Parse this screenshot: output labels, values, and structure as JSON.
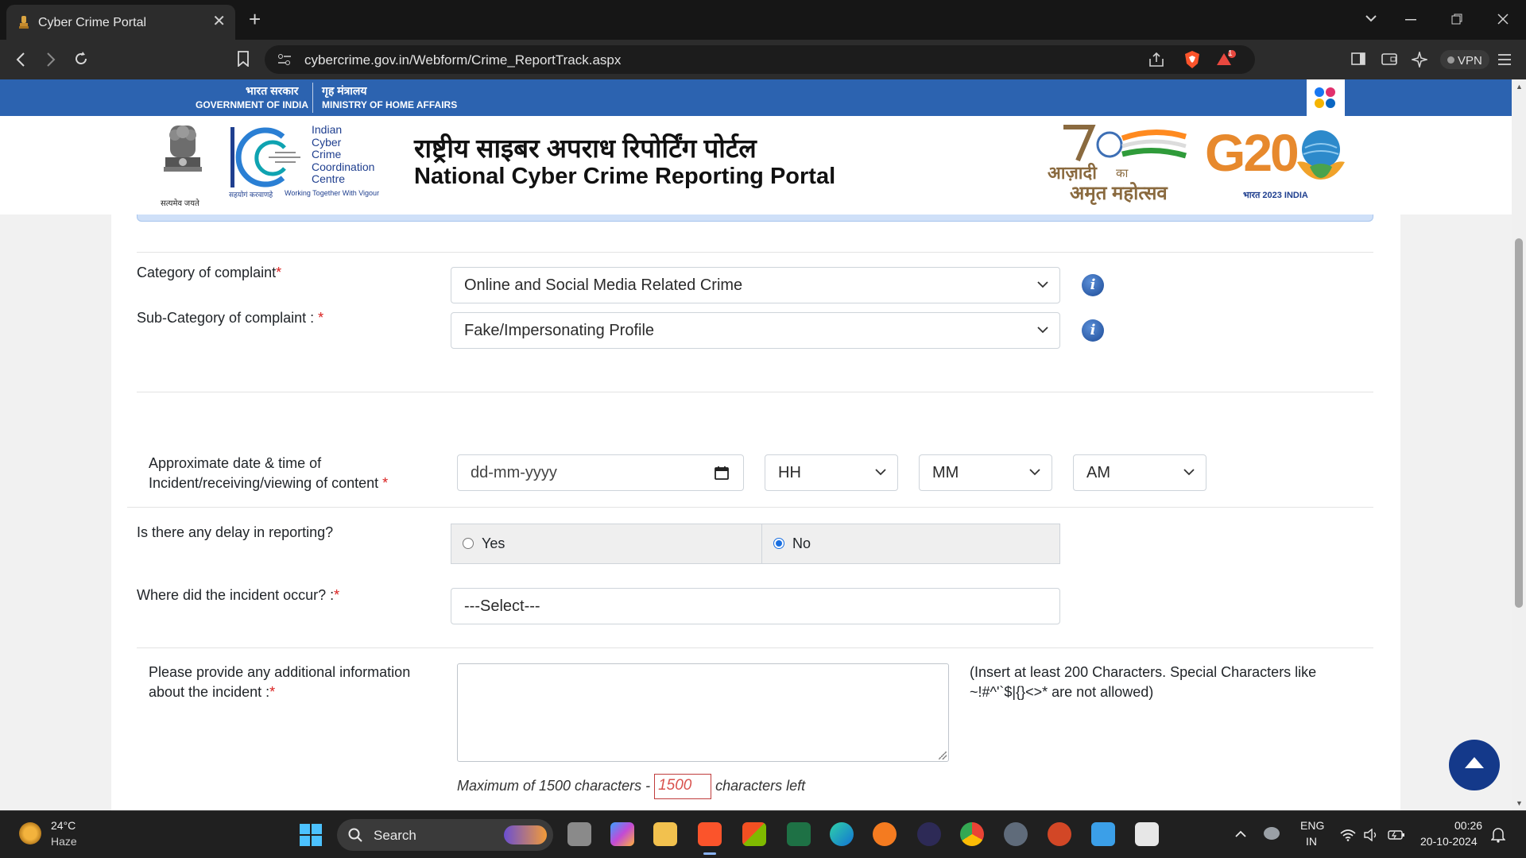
{
  "browser": {
    "tab_title": "Cyber Crime Portal",
    "tab_close": "✕",
    "new_tab": "+",
    "url": "cybercrime.gov.in/Webform/Crime_ReportTrack.aspx",
    "vpn_label": "VPN",
    "badge_count": "1"
  },
  "gov_bar": {
    "hindi_gov": "भारत सरकार",
    "english_gov": "GOVERNMENT OF INDIA",
    "hindi_ministry": "गृह मंत्रालय",
    "english_ministry": "MINISTRY OF HOME AFFAIRS"
  },
  "header": {
    "i4c_lines": [
      "Indian",
      "Cyber",
      "Crime",
      "Coordination",
      "Centre"
    ],
    "i4c_tagline_hi": "सहयोगं करवाणहे",
    "i4c_tagline_en": "Working Together With Vigour",
    "emblem_caption": "सत्यमेव जयते",
    "title_hindi": "राष्ट्रीय साइबर अपराध रिपोर्टिंग पोर्टल",
    "title_english": "National Cyber Crime Reporting Portal",
    "azadi_line1": "आज़ादी",
    "azadi_ka": "का",
    "azadi_line2": "अमृत महोत्सव",
    "g20_text": "G20",
    "g20_sub": "भारत 2023 INDIA"
  },
  "form": {
    "category_label": "Category of complaint",
    "category_value": "Online and Social Media Related Crime",
    "subcategory_label": "Sub-Category of complaint : ",
    "subcategory_value": "Fake/Impersonating Profile",
    "datetime_label": "Approximate date & time of Incident/receiving/viewing of content ",
    "date_placeholder": "dd-mm-yyyy",
    "hour_value": "HH",
    "minute_value": "MM",
    "ampm_value": "AM",
    "delay_label": "Is there any delay in reporting?",
    "delay_yes": "Yes",
    "delay_no": "No",
    "delay_selected": "No",
    "location_label": "Where did the incident occur? :",
    "location_value": "---Select---",
    "info_label": "Please provide any additional information about the incident :",
    "info_hint": "(Insert at least 200 Characters. Special Characters like ~!#^'`$|{}<>* are not allowed)",
    "counter_prefix": "Maximum of 1500 characters - ",
    "counter_value": "1500",
    "counter_suffix": " characters left",
    "required_mark": "*",
    "info_icon_glyph": "i"
  },
  "taskbar": {
    "temperature": "24°C",
    "weather": "Haze",
    "search_label": "Search",
    "lang_line1": "ENG",
    "lang_line2": "IN",
    "time": "00:26",
    "date": "20-10-2024"
  },
  "colors": {
    "gov_bar": "#2c63b0",
    "required": "#d9201f",
    "radio_accent": "#1a6fe0",
    "scroll_to_top": "#14398a"
  }
}
